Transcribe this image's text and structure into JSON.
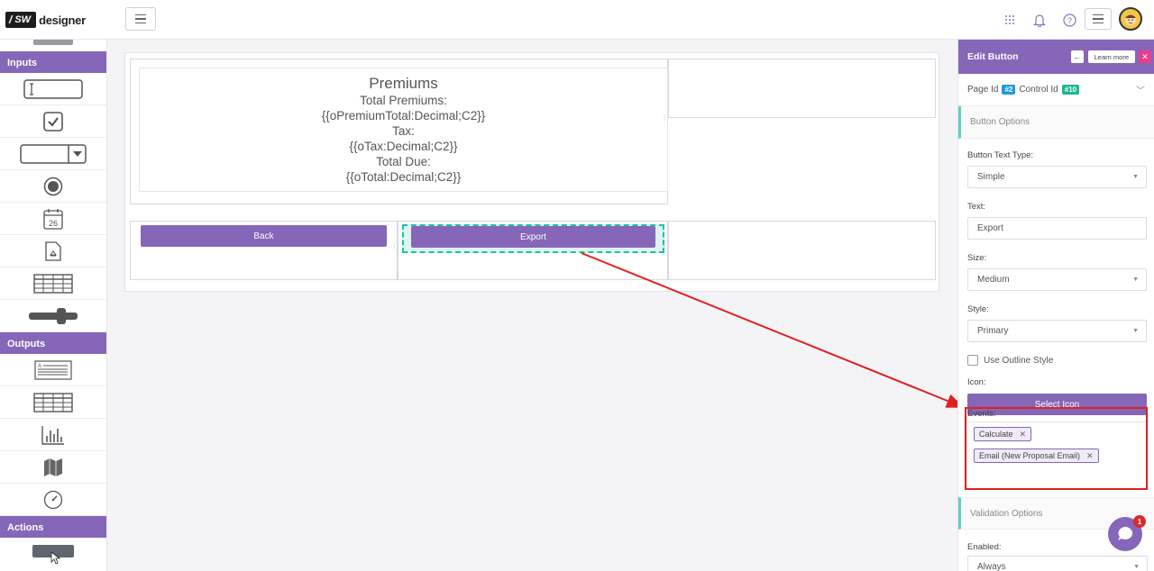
{
  "app": {
    "logo_badge": "SW",
    "logo_text": "designer"
  },
  "left_panel": {
    "sections": {
      "inputs": "Inputs",
      "outputs": "Outputs",
      "actions": "Actions"
    },
    "calendar_day": "26"
  },
  "canvas": {
    "premiums": {
      "title": "Premiums",
      "lines": [
        "Total Premiums:",
        "{{oPremiumTotal:Decimal;C2}}",
        "Tax:",
        "{{oTax:Decimal;C2}}",
        "Total Due:",
        "{{oTotal:Decimal;C2}}"
      ]
    },
    "back_label": "Back",
    "export_label": "Export"
  },
  "right_panel": {
    "title": "Edit Button",
    "learn_more": "Learn more",
    "page_id_label": "Page Id",
    "page_id_value": "#2",
    "control_id_label": "Control Id",
    "control_id_value": "#10",
    "button_options": "Button Options",
    "text_type_label": "Button Text Type:",
    "text_type_value": "Simple",
    "text_label": "Text:",
    "text_value": "Export",
    "size_label": "Size:",
    "size_value": "Medium",
    "style_label": "Style:",
    "style_value": "Primary",
    "outline_label": "Use Outline Style",
    "icon_label": "Icon:",
    "select_icon": "Select Icon",
    "events_label": "Events:",
    "events": [
      "Calculate",
      "Email (New Proposal Email)"
    ],
    "validation_options": "Validation Options",
    "enabled_label": "Enabled:",
    "enabled_value": "Always"
  },
  "chat": {
    "badge_count": "1"
  },
  "colors": {
    "accent": "#8566b8",
    "annotation": "#e02020",
    "selection": "#18c3a8"
  }
}
